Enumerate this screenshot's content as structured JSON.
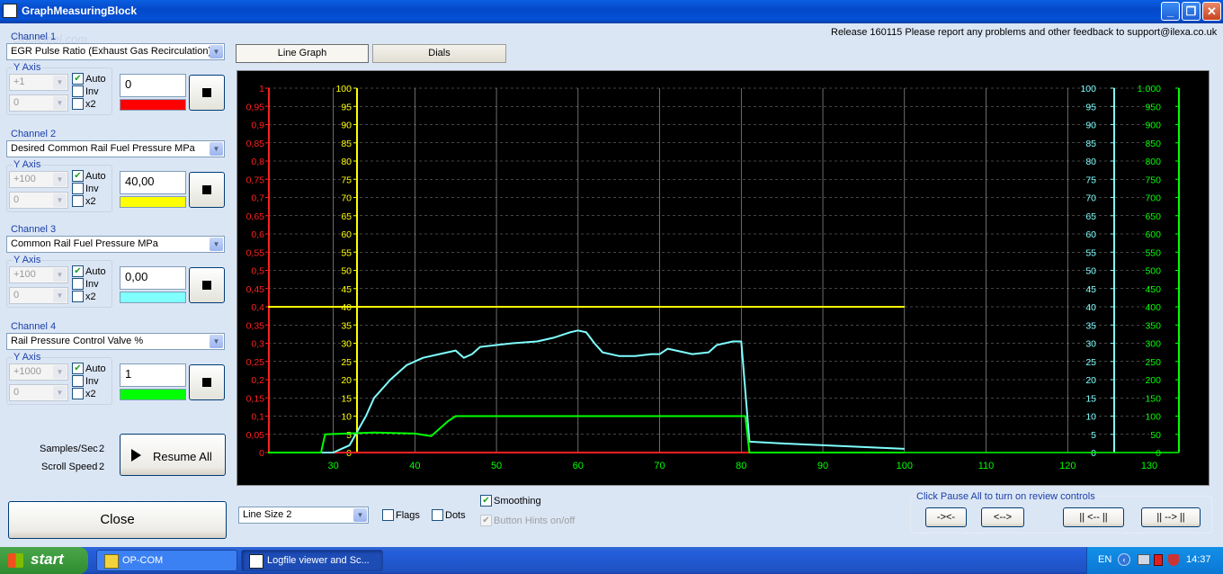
{
  "window": {
    "title": "GraphMeasuringBlock",
    "watermark": "OpelOpel.com"
  },
  "release_notice": "Release 160115 Please report any problems and other feedback to support@ilexa.co.uk",
  "tabs": [
    "Line Graph",
    "Dials"
  ],
  "channels": [
    {
      "label": "Channel 1",
      "signal": "EGR Pulse Ratio (Exhaust Gas Recirculation) '",
      "yaxis_label": "Y Axis",
      "max": "+1",
      "min": "0",
      "auto_label": "Auto",
      "auto": true,
      "inv_label": "Inv",
      "x2_label": "x2",
      "value": "0",
      "color": "#ff0000"
    },
    {
      "label": "Channel 2",
      "signal": "Desired Common Rail Fuel Pressure  MPa",
      "yaxis_label": "Y Axis",
      "max": "+100",
      "min": "0",
      "auto_label": "Auto",
      "auto": true,
      "inv_label": "Inv",
      "x2_label": "x2",
      "value": "40,00",
      "color": "#ffff00"
    },
    {
      "label": "Channel 3",
      "signal": "Common Rail Fuel Pressure  MPa",
      "yaxis_label": "Y Axis",
      "max": "+100",
      "min": "0",
      "auto_label": "Auto",
      "auto": true,
      "inv_label": "Inv",
      "x2_label": "x2",
      "value": "0,00",
      "color": "#80ffff"
    },
    {
      "label": "Channel 4",
      "signal": "Rail Pressure Control Valve  %",
      "yaxis_label": "Y Axis",
      "max": "+1000",
      "min": "0",
      "auto_label": "Auto",
      "auto": true,
      "inv_label": "Inv",
      "x2_label": "x2",
      "value": "1",
      "color": "#00ff00"
    }
  ],
  "stats": {
    "samples_label": "Samples/Sec",
    "samples": "2",
    "scroll_label": "Scroll Speed",
    "scroll": "2"
  },
  "buttons": {
    "resume_all": "Resume All",
    "close": "Close",
    "zoom_in": "-><-",
    "zoom_out": "<-->",
    "back": "|| <-- ||",
    "forward": "|| --> ||"
  },
  "bottom": {
    "line_size": "Line Size 2",
    "flags": "Flags",
    "dots": "Dots",
    "smoothing": "Smoothing",
    "button_hints": "Button Hints on/off",
    "pause_hint": "Click Pause All to turn on review controls"
  },
  "taskbar": {
    "start": "start",
    "items": [
      "OP-COM",
      "Logfile viewer and Sc..."
    ],
    "lang": "EN",
    "clock": "14:37"
  },
  "chart_data": {
    "type": "line",
    "x_ticks": [
      30,
      40,
      50,
      60,
      70,
      80,
      90,
      100,
      110,
      120,
      130
    ],
    "xlim": [
      22,
      130
    ],
    "axes": [
      {
        "color": "#ff2020",
        "ylim": [
          0,
          1
        ],
        "ticks": [
          "0",
          "0,05",
          "0,1",
          "0,15",
          "0,2",
          "0,25",
          "0,3",
          "0,35",
          "0,4",
          "0,45",
          "0,5",
          "0,55",
          "0,6",
          "0,65",
          "0,7",
          "0,75",
          "0,8",
          "0,85",
          "0,9",
          "0,95",
          "1"
        ]
      },
      {
        "color": "#ffff00",
        "ylim": [
          0,
          100
        ],
        "ticks": [
          "0",
          "5",
          "10",
          "15",
          "20",
          "25",
          "30",
          "35",
          "40",
          "45",
          "50",
          "55",
          "60",
          "65",
          "70",
          "75",
          "80",
          "85",
          "90",
          "95",
          "100"
        ]
      },
      {
        "color": "#80ffff",
        "ylim": [
          0,
          100
        ],
        "ticks": [
          "0",
          "5",
          "10",
          "15",
          "20",
          "25",
          "30",
          "35",
          "40",
          "45",
          "50",
          "55",
          "60",
          "65",
          "70",
          "75",
          "80",
          "85",
          "90",
          "95",
          "100"
        ]
      },
      {
        "color": "#00ff00",
        "ylim": [
          0,
          1000
        ],
        "ticks": [
          "0",
          "50",
          "100",
          "150",
          "200",
          "250",
          "300",
          "350",
          "400",
          "450",
          "500",
          "550",
          "600",
          "650",
          "700",
          "750",
          "800",
          "850",
          "900",
          "950",
          "1.000"
        ]
      }
    ],
    "series": [
      {
        "axis": 0,
        "color": "#ff2020",
        "points": [
          [
            22,
            0
          ],
          [
            81,
            0
          ]
        ]
      },
      {
        "axis": 1,
        "color": "#ffff00",
        "points": [
          [
            22,
            40
          ],
          [
            100,
            40
          ]
        ]
      },
      {
        "axis": 2,
        "color": "#80ffff",
        "points": [
          [
            22,
            0
          ],
          [
            30,
            0
          ],
          [
            32,
            2
          ],
          [
            34,
            10
          ],
          [
            35,
            15
          ],
          [
            37,
            20
          ],
          [
            39,
            24
          ],
          [
            41,
            26
          ],
          [
            43,
            27
          ],
          [
            45,
            28
          ],
          [
            46,
            26
          ],
          [
            47,
            27
          ],
          [
            48,
            29
          ],
          [
            50,
            29.5
          ],
          [
            52,
            30
          ],
          [
            55,
            30.5
          ],
          [
            57,
            31.5
          ],
          [
            59,
            33
          ],
          [
            60,
            33.5
          ],
          [
            61,
            33
          ],
          [
            62,
            30
          ],
          [
            63,
            27.5
          ],
          [
            65,
            26.5
          ],
          [
            67,
            26.5
          ],
          [
            69,
            27
          ],
          [
            70,
            27
          ],
          [
            71,
            28.5
          ],
          [
            72,
            28
          ],
          [
            74,
            27
          ],
          [
            76,
            27.5
          ],
          [
            77,
            29.5
          ],
          [
            79,
            30.5
          ],
          [
            80,
            30.5
          ],
          [
            81,
            3
          ],
          [
            85,
            2.5
          ],
          [
            90,
            2
          ],
          [
            95,
            1.5
          ],
          [
            100,
            1
          ]
        ]
      },
      {
        "axis": 3,
        "color": "#00ff00",
        "points": [
          [
            22,
            0
          ],
          [
            28.5,
            0
          ],
          [
            29,
            50
          ],
          [
            35,
            55
          ],
          [
            40,
            52
          ],
          [
            42,
            45
          ],
          [
            44,
            85
          ],
          [
            45,
            100
          ],
          [
            80.5,
            100
          ],
          [
            81,
            0
          ],
          [
            100,
            0
          ]
        ]
      }
    ]
  }
}
